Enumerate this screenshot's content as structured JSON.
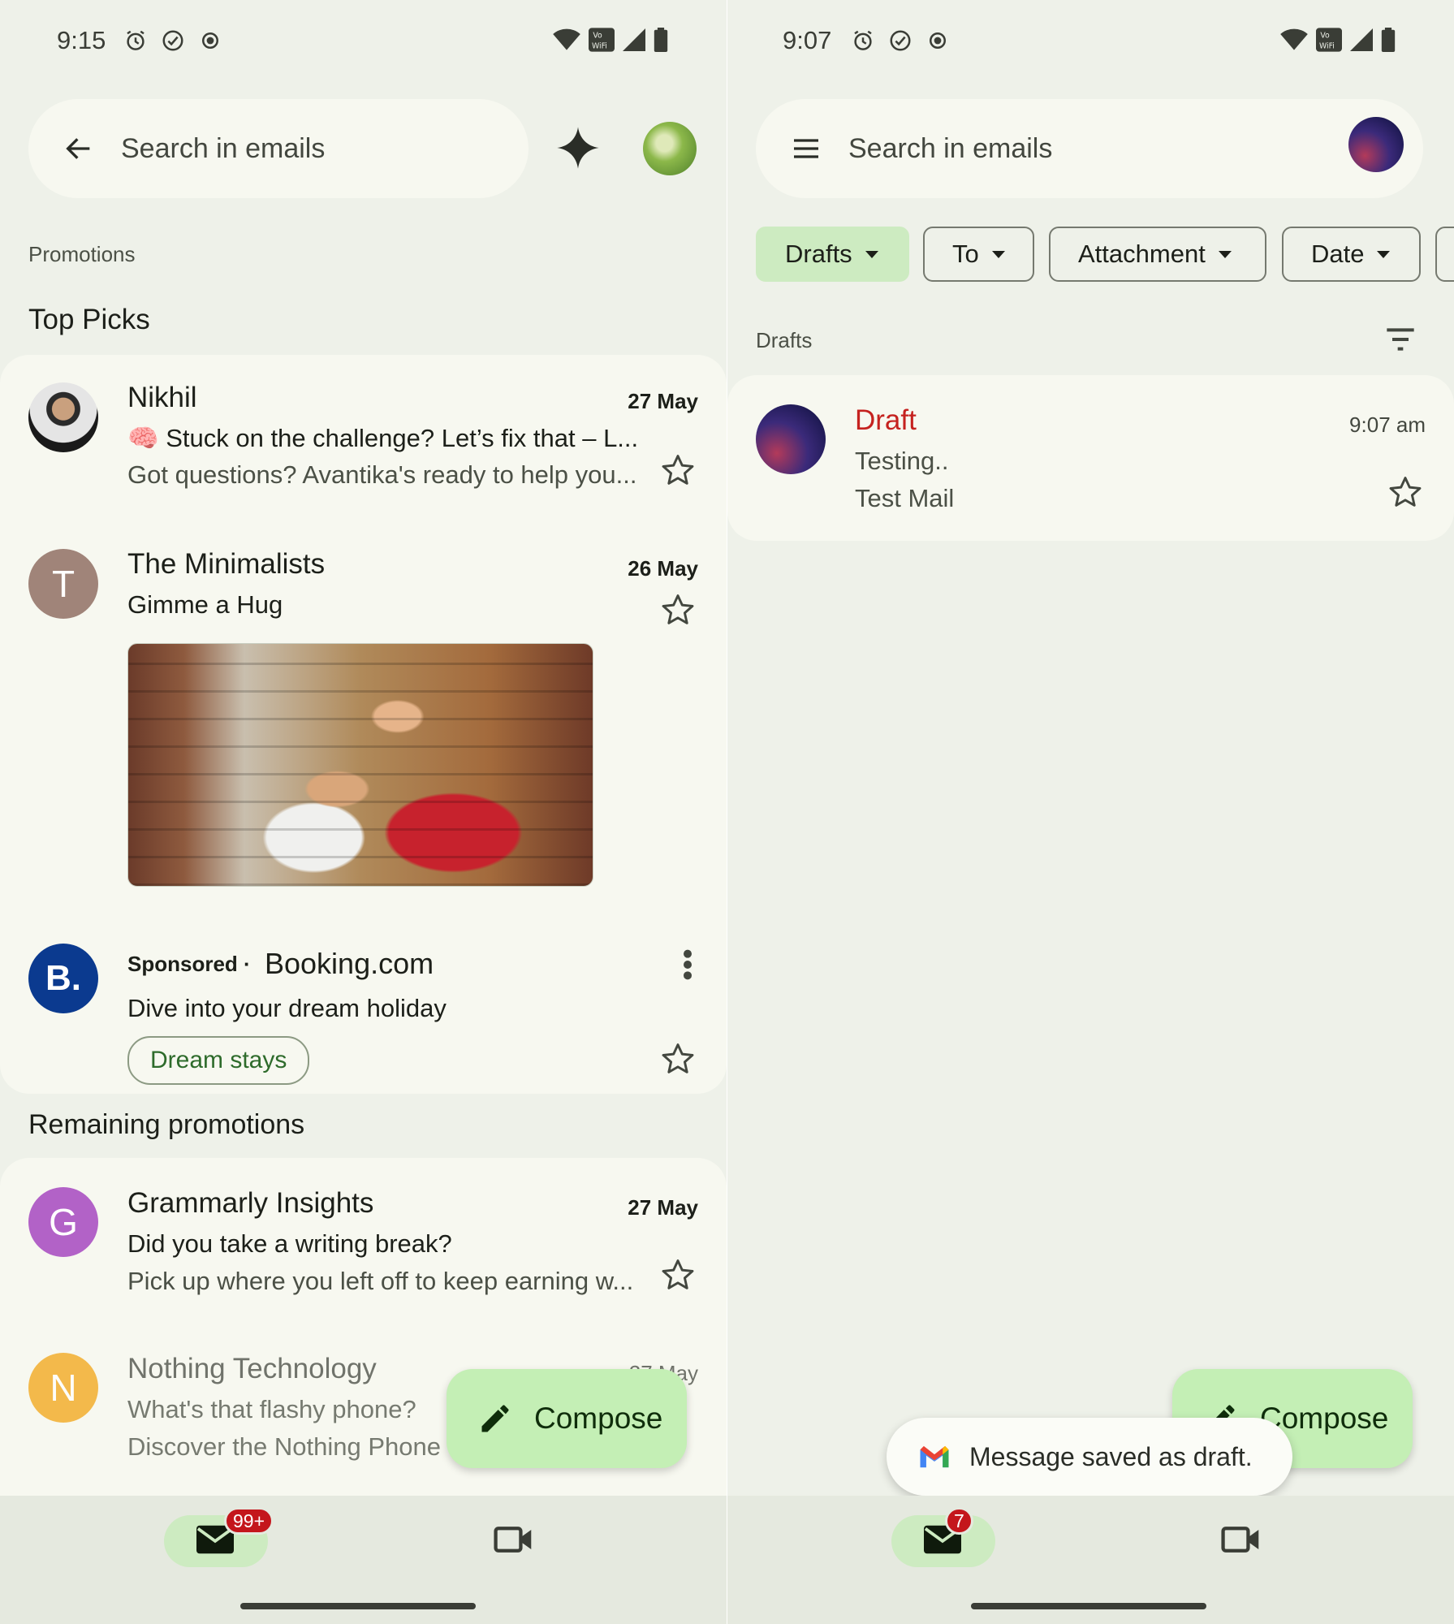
{
  "left": {
    "status_bar": {
      "time": "9:15"
    },
    "search": {
      "placeholder": "Search in emails"
    },
    "section_label": "Promotions",
    "top_picks_label": "Top Picks",
    "emails_top": [
      {
        "sender": "Nikhil",
        "date": "27 May",
        "subject_emoji": "🧠",
        "subject": "Stuck on the challenge? Let’s fix that – L...",
        "snippet": "Got questions? Avantika's ready to help you..."
      },
      {
        "sender": "The Minimalists",
        "avatar_letter": "T",
        "date": "26 May",
        "subject": "Gimme a Hug"
      }
    ],
    "ad": {
      "avatar_text": "B.",
      "sponsored": "Sponsored",
      "separator": "·",
      "sender": "Booking.com",
      "subject": "Dive into your dream holiday",
      "chip": "Dream stays"
    },
    "remaining_label": "Remaining promotions",
    "emails_remaining": [
      {
        "sender": "Grammarly Insights",
        "avatar_letter": "G",
        "date": "27 May",
        "subject": "Did you take a writing break?",
        "snippet": "Pick up where you left off to keep earning w..."
      },
      {
        "sender": "Nothing Technology",
        "avatar_letter": "N",
        "date": "27 May",
        "subject": "What's that flashy phone?",
        "snippet": "Discover the Nothing Phone"
      }
    ],
    "compose_label": "Compose",
    "mail_badge": "99+"
  },
  "right": {
    "status_bar": {
      "time": "9:07"
    },
    "search": {
      "placeholder": "Search in emails"
    },
    "filters": [
      "Drafts",
      "To",
      "Attachment",
      "Date"
    ],
    "section_label": "Drafts",
    "draft": {
      "label": "Draft",
      "time": "9:07 am",
      "subject": "Testing..",
      "snippet": "Test Mail"
    },
    "compose_label": "Compose",
    "snackbar": "Message saved as draft.",
    "mail_badge": "7"
  },
  "colors": {
    "background": "#eef1e9",
    "card": "#f7f8f0",
    "accent_green": "#c4efb5",
    "draft_red": "#c5221f",
    "badge_red": "#c4161c"
  }
}
